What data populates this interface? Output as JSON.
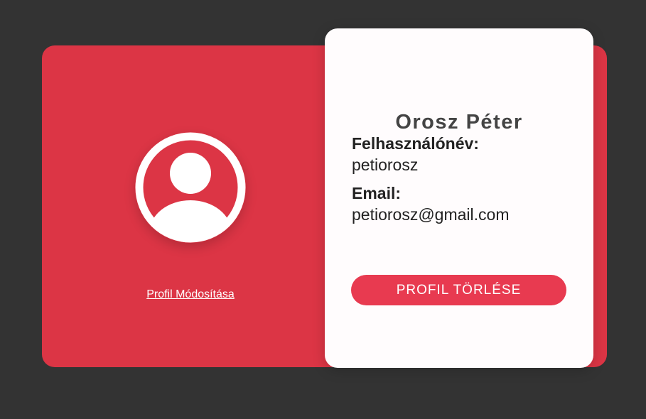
{
  "profile": {
    "name": "Orosz Péter",
    "edit_link": "Profil Módosítása",
    "username_label": "Felhasználónév:",
    "username": "petiorosz",
    "email_label": "Email:",
    "email": "petiorosz@gmail.com",
    "delete_button": "PROFIL TÖRLÉSE",
    "avatar_icon": "user-circle-icon"
  },
  "colors": {
    "background": "#333333",
    "accent": "#dc3545",
    "button": "#e83a50",
    "card": "#fffcfd",
    "text": "#222222"
  }
}
